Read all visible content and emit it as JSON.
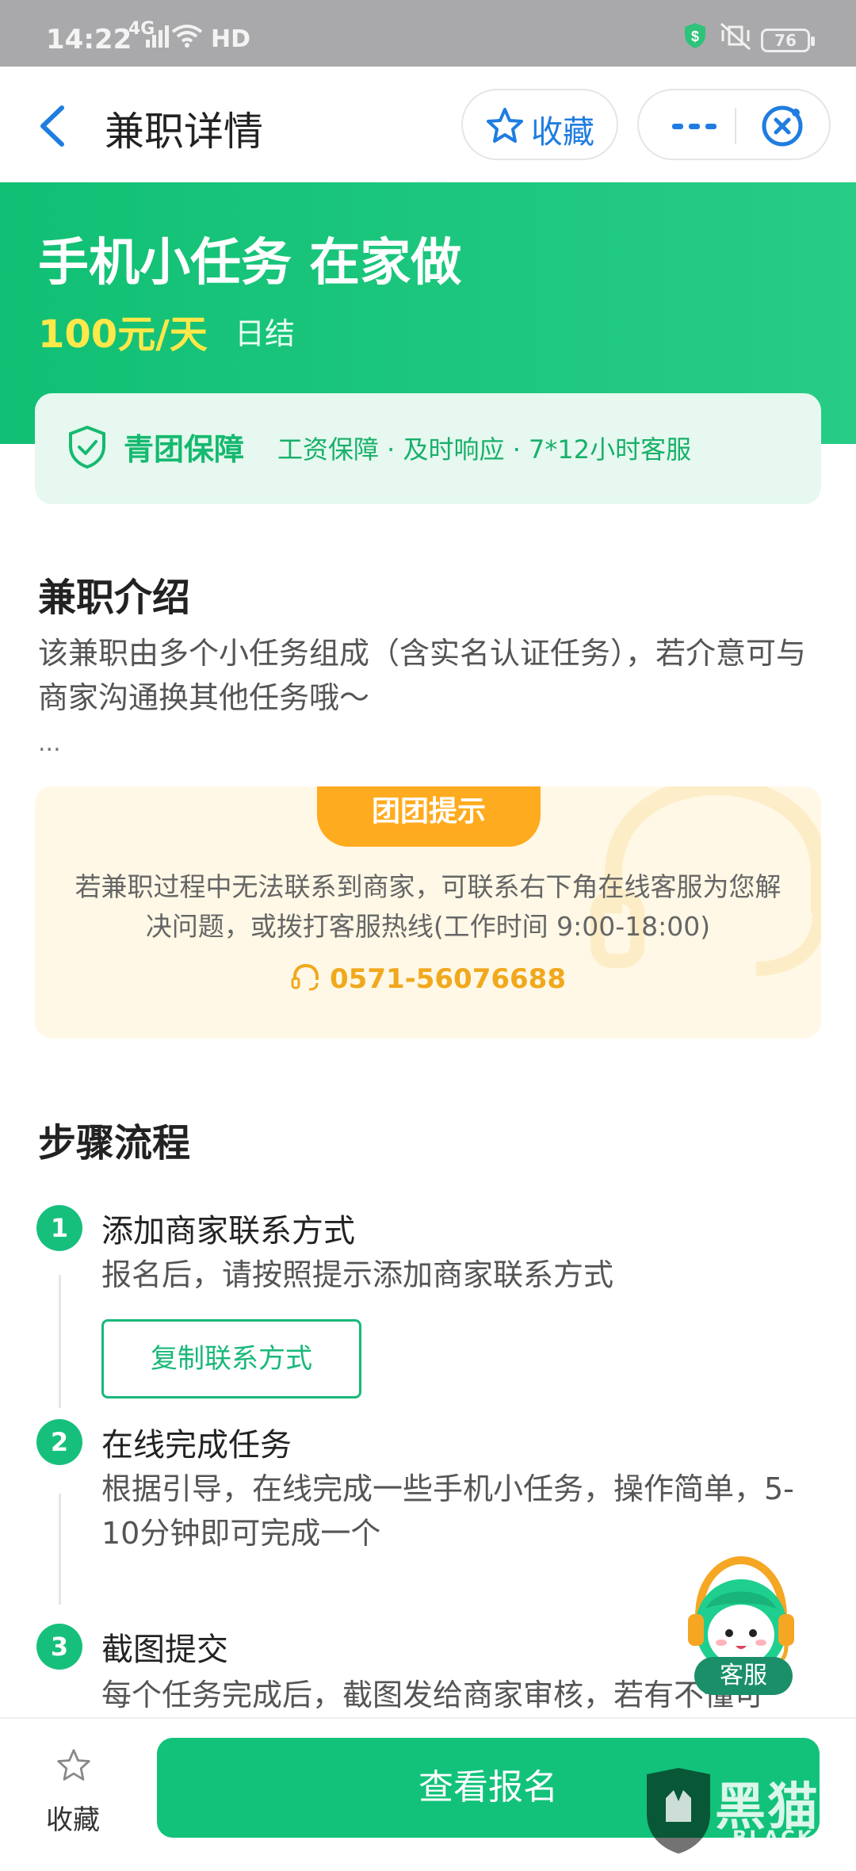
{
  "status_bar": {
    "time": "14:22",
    "network": "4G",
    "hd": "HD",
    "battery": "76"
  },
  "nav": {
    "title": "兼职详情",
    "favorite_label": "收藏"
  },
  "job": {
    "title": "手机小任务 在家做",
    "salary": "100元/天",
    "settlement": "日结"
  },
  "guarantee": {
    "title": "青团保障",
    "desc": "工资保障 · 及时响应 · 7*12小时客服"
  },
  "intro": {
    "heading": "兼职介绍",
    "text": "该兼职由多个小任务组成（含实名认证任务），若介意可与商家沟通换其他任务哦～",
    "more": "..."
  },
  "tip": {
    "tab": "团团提示",
    "text": "若兼职过程中无法联系到商家，可联系右下角在线客服为您解决问题，或拨打客服热线(工作时间 9:00-18:00)",
    "phone": "0571-56076688"
  },
  "steps": {
    "heading": "步骤流程",
    "items": [
      {
        "num": "1",
        "title": "添加商家联系方式",
        "desc": "报名后，请按照提示添加商家联系方式",
        "button": "复制联系方式"
      },
      {
        "num": "2",
        "title": "在线完成任务",
        "desc": "根据引导，在线完成一些手机小任务，操作简单，5-10分钟即可完成一个"
      },
      {
        "num": "3",
        "title": "截图提交",
        "desc": "每个任务完成后，截图发给商家审核，若有不懂可"
      }
    ]
  },
  "customer_service": {
    "label": "客服"
  },
  "bottom_bar": {
    "favorite_label": "收藏",
    "apply_label": "查看报名"
  },
  "watermark": {
    "cn": "黑猫",
    "en": "BLACK CAT"
  },
  "colors": {
    "brand_green": "#12c27a",
    "salary_yellow": "#ffe94a",
    "tip_orange": "#ffab1f",
    "link_blue": "#1f7de0"
  }
}
